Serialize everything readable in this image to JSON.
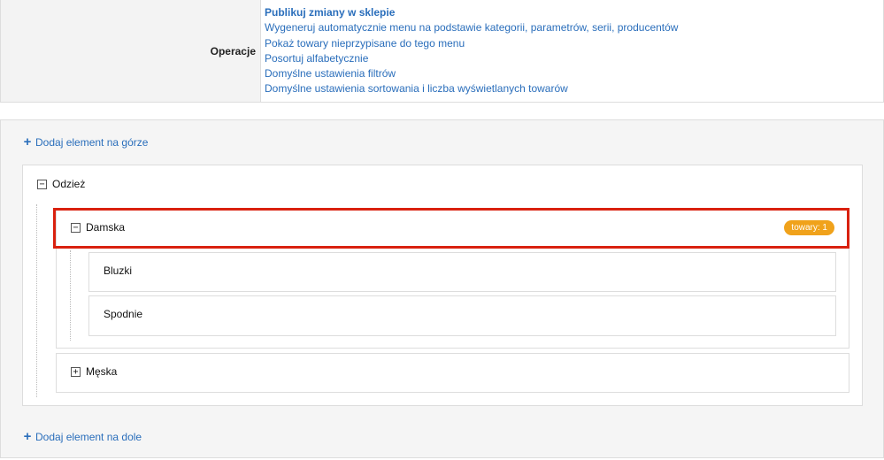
{
  "operations": {
    "label": "Operacje",
    "links": [
      {
        "label": "Publikuj zmiany w sklepie",
        "bold": true
      },
      {
        "label": "Wygeneruj automatycznie menu na podstawie kategorii, parametrów, serii, producentów"
      },
      {
        "label": "Pokaż towary nieprzypisane do tego menu"
      },
      {
        "label": "Posortuj alfabetycznie"
      },
      {
        "label": "Domyślne ustawienia filtrów"
      },
      {
        "label": "Domyślne ustawienia sortowania i liczba wyświetlanych towarów"
      }
    ]
  },
  "tree": {
    "add_top_label": "Dodaj element na górze",
    "add_bottom_label": "Dodaj element na dole",
    "root": {
      "label": "Odzież",
      "toggle": "−",
      "children": [
        {
          "label": "Damska",
          "toggle": "−",
          "badge": "towary: 1",
          "children": [
            {
              "label": "Bluzki"
            },
            {
              "label": "Spodnie"
            }
          ]
        },
        {
          "label": "Męska",
          "toggle": "+"
        }
      ]
    }
  },
  "colors": {
    "link": "#2a6ebb",
    "badge": "#f0a21b",
    "highlight": "#d9210f"
  }
}
